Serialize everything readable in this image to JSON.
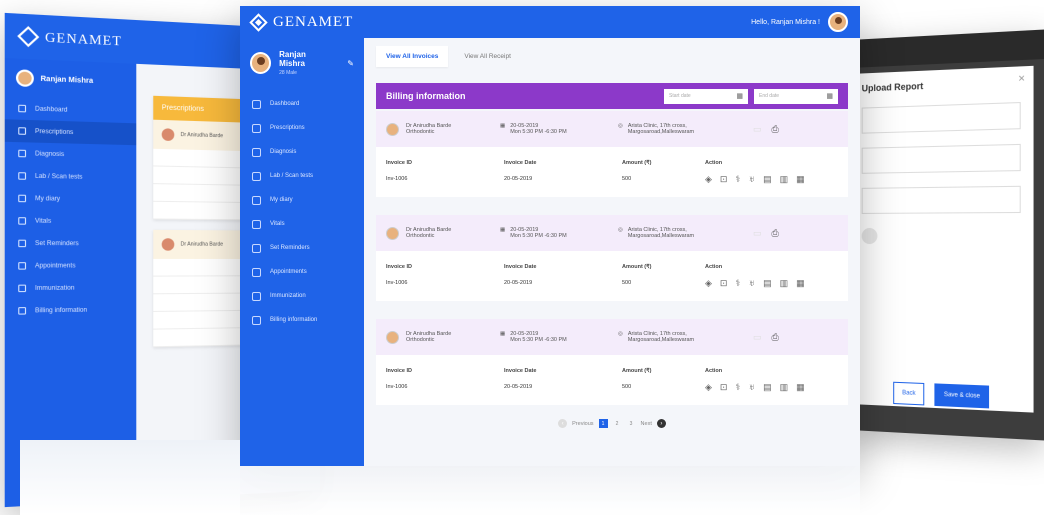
{
  "app": {
    "brand": "GENAMET",
    "greeting": "Hello, Ranjan Mishra !"
  },
  "user": {
    "name": "Ranjan Mishra",
    "sub": "28 Male"
  },
  "sidebar": {
    "items": [
      {
        "label": "Dashboard"
      },
      {
        "label": "Prescriptions"
      },
      {
        "label": "Diagnosis"
      },
      {
        "label": "Lab / Scan tests"
      },
      {
        "label": "My diary"
      },
      {
        "label": "Vitals"
      },
      {
        "label": "Set Reminders"
      },
      {
        "label": "Appointments"
      },
      {
        "label": "Immunization"
      },
      {
        "label": "Billing information"
      }
    ]
  },
  "tabs": [
    {
      "label": "View All Invoices"
    },
    {
      "label": "View All Receipt"
    }
  ],
  "billing": {
    "title": "Billing information",
    "start_placeholder": "Start date",
    "end_placeholder": "End date"
  },
  "columns": {
    "invoice_id": "Invoice ID",
    "invoice_date": "Invoice Date",
    "amount": "Amount (₹)",
    "action": "Action"
  },
  "records": [
    {
      "doctor": "Dr Anirudha Barde",
      "specialty": "Orthodontic",
      "date": "20-05-2019",
      "time": "Mon 5:30 PM -6:30 PM",
      "location_1": "Arista Clinic, 17th cross,",
      "location_2": "Margosaroad,Malleswaram",
      "invoice_id": "Inv-1006",
      "invoice_date": "20-05-2019",
      "amount": "500"
    },
    {
      "doctor": "Dr Anirudha Barde",
      "specialty": "Orthodontic",
      "date": "20-05-2019",
      "time": "Mon 5:30 PM -6:30 PM",
      "location_1": "Arista Clinic, 17th cross,",
      "location_2": "Margosaroad,Malleswaram",
      "invoice_id": "Inv-1006",
      "invoice_date": "20-05-2019",
      "amount": "500"
    },
    {
      "doctor": "Dr Anirudha Barde",
      "specialty": "Orthodontic",
      "date": "20-05-2019",
      "time": "Mon 5:30 PM -6:30 PM",
      "location_1": "Arista Clinic, 17th cross,",
      "location_2": "Margosaroad,Malleswaram",
      "invoice_id": "Inv-1006",
      "invoice_date": "20-05-2019",
      "amount": "500"
    }
  ],
  "pagination": {
    "previous": "Previous",
    "pages": [
      "1",
      "2",
      "3"
    ],
    "next": "Next",
    "active": "1"
  },
  "left_screen": {
    "brand": "GENAMET",
    "user": "Ranjan Mishra",
    "card_title": "Prescriptions",
    "items": [
      "Dashboard",
      "Prescriptions",
      "Diagnosis",
      "Lab / Scan tests",
      "My diary",
      "Vitals",
      "Set Reminders",
      "Appointments",
      "Immunization",
      "Billing information"
    ]
  },
  "right_screen": {
    "title": "Upload Report",
    "back": "Back",
    "save": "Save & close",
    "close": "×"
  },
  "colors": {
    "primary": "#1f63e8",
    "billing_header": "#8c39c9",
    "record_header": "#f4ecfb"
  }
}
